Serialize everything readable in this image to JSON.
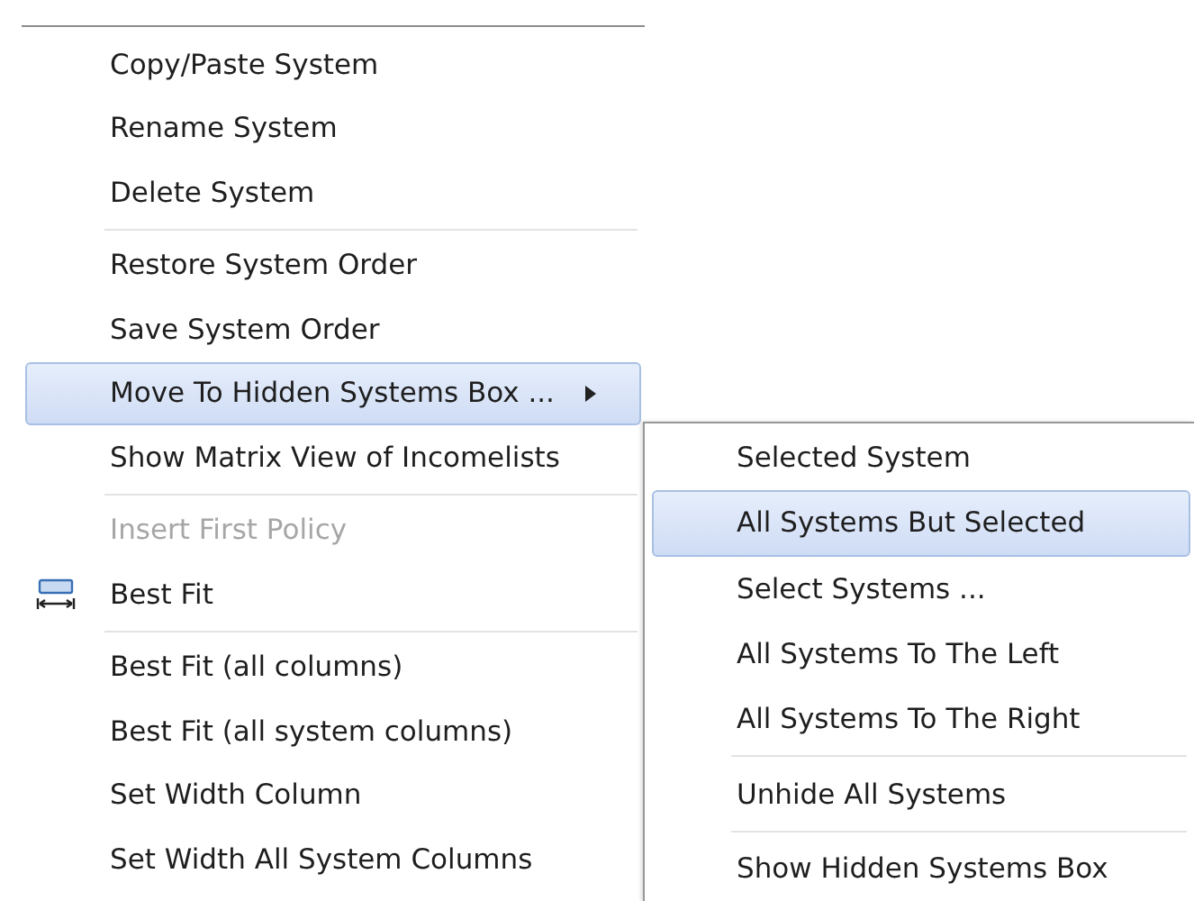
{
  "menu": {
    "items": [
      {
        "kind": "item",
        "label": "Copy/Paste System",
        "selected": false,
        "disabled": false,
        "has_submenu": false
      },
      {
        "kind": "item",
        "label": "Rename System",
        "selected": false,
        "disabled": false,
        "has_submenu": false
      },
      {
        "kind": "item",
        "label": "Delete System",
        "selected": false,
        "disabled": false,
        "has_submenu": false
      },
      {
        "kind": "separator"
      },
      {
        "kind": "item",
        "label": "Restore System Order",
        "selected": false,
        "disabled": false,
        "has_submenu": false
      },
      {
        "kind": "item",
        "label": "Save System Order",
        "selected": false,
        "disabled": false,
        "has_submenu": false
      },
      {
        "kind": "item",
        "label": "Move To Hidden Systems Box ...",
        "selected": true,
        "disabled": false,
        "has_submenu": true
      },
      {
        "kind": "item",
        "label": "Show Matrix View of Incomelists",
        "selected": false,
        "disabled": false,
        "has_submenu": false
      },
      {
        "kind": "separator"
      },
      {
        "kind": "item",
        "label": "Insert First Policy",
        "selected": false,
        "disabled": true,
        "has_submenu": false
      },
      {
        "kind": "icon-item",
        "label": "Best Fit",
        "selected": false,
        "disabled": false,
        "has_submenu": false
      },
      {
        "kind": "separator"
      },
      {
        "kind": "item",
        "label": "Best Fit (all columns)",
        "selected": false,
        "disabled": false,
        "has_submenu": false
      },
      {
        "kind": "item",
        "label": "Best Fit (all system columns)",
        "selected": false,
        "disabled": false,
        "has_submenu": false
      },
      {
        "kind": "item",
        "label": "Set Width Column",
        "selected": false,
        "disabled": false,
        "has_submenu": false
      },
      {
        "kind": "item",
        "label": "Set Width All System Columns",
        "selected": false,
        "disabled": false,
        "has_submenu": false
      }
    ]
  },
  "submenu": {
    "items": [
      {
        "kind": "item",
        "label": "Selected System",
        "selected": false
      },
      {
        "kind": "item",
        "label": "All Systems But Selected",
        "selected": true
      },
      {
        "kind": "item",
        "label": "Select Systems ...",
        "selected": false
      },
      {
        "kind": "item",
        "label": "All Systems To The Left",
        "selected": false
      },
      {
        "kind": "item",
        "label": "All Systems To The Right",
        "selected": false
      },
      {
        "kind": "separator"
      },
      {
        "kind": "item",
        "label": "Unhide All Systems",
        "selected": false
      },
      {
        "kind": "separator"
      },
      {
        "kind": "item",
        "label": "Show Hidden Systems Box",
        "selected": false
      }
    ]
  }
}
